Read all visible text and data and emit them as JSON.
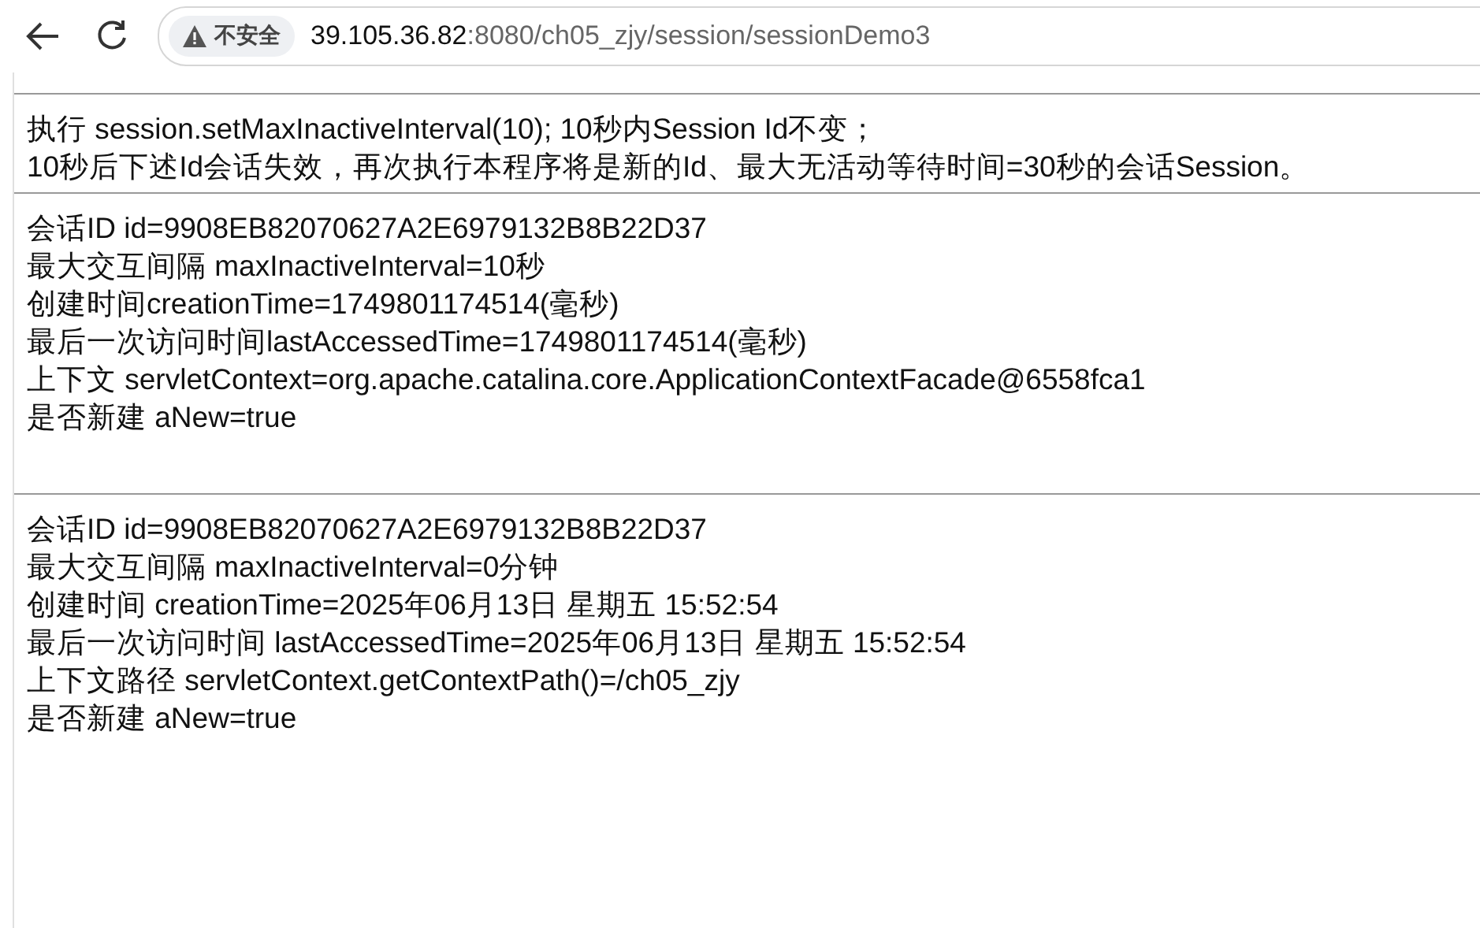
{
  "browser": {
    "security_label": "不安全",
    "url_host": "39.105.36.82",
    "url_path": ":8080/ch05_zjy/session/sessionDemo3"
  },
  "intro": [
    "执行 session.setMaxInactiveInterval(10); 10秒内Session Id不变；",
    "10秒后下述Id会话失效，再次执行本程序将是新的Id、最大无活动等待时间=30秒的会话Session。"
  ],
  "sections": [
    {
      "lines": [
        "会话ID id=9908EB82070627A2E6979132B8B22D37",
        "最大交互间隔 maxInactiveInterval=10秒",
        "创建时间creationTime=1749801174514(毫秒)",
        "最后一次访问时间lastAccessedTime=1749801174514(毫秒)",
        "上下文 servletContext=org.apache.catalina.core.ApplicationContextFacade@6558fca1",
        "是否新建 aNew=true"
      ]
    },
    {
      "lines": [
        "会话ID id=9908EB82070627A2E6979132B8B22D37",
        "最大交互间隔 maxInactiveInterval=0分钟",
        "创建时间 creationTime=2025年06月13日 星期五 15:52:54",
        "最后一次访问时间 lastAccessedTime=2025年06月13日 星期五 15:52:54",
        "上下文路径 servletContext.getContextPath()=/ch05_zjy",
        "是否新建 aNew=true"
      ]
    }
  ]
}
